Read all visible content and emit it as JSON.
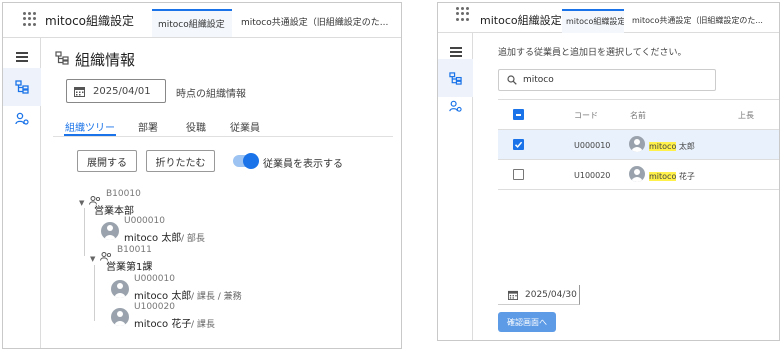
{
  "left": {
    "app_title": "mitoco組織設定",
    "tabs": [
      {
        "label": "mitoco組織設定"
      },
      {
        "label": "mitoco共通設定（旧組織設定のた..."
      }
    ],
    "page_title": "組織情報",
    "date": "2025/04/01",
    "date_suffix": "時点の組織情報",
    "subtabs": [
      "組織ツリー",
      "部署",
      "役職",
      "従業員"
    ],
    "buttons": {
      "expand": "展開する",
      "collapse": "折りたたむ"
    },
    "toggle_label": "従業員を表示する",
    "tree": {
      "dept1": {
        "code": "B10010",
        "name": "営業本部"
      },
      "emp1": {
        "code": "U000010",
        "name": "mitoco 太郎",
        "role": "/ 部長"
      },
      "dept2": {
        "code": "B10011",
        "name": "営業第1課"
      },
      "emp2": {
        "code": "U000010",
        "name": "mitoco 太郎",
        "role": "/ 課長 / 兼務"
      },
      "emp3": {
        "code": "U100020",
        "name": "mitoco 花子",
        "role": "/ 課長"
      }
    }
  },
  "right": {
    "app_title": "mitoco組織設定",
    "tabs": [
      {
        "label": "mitoco組織設定"
      },
      {
        "label": "mitoco共通設定（旧組織設定のた..."
      }
    ],
    "instruction": "追加する従業員と追加日を選択してください。",
    "search_value": "mitoco",
    "table": {
      "headers": {
        "code": "コード",
        "name": "名前",
        "title": "上長"
      },
      "rows": [
        {
          "code": "U000010",
          "name_hl": "mitoco",
          "name_rest": " 太郎",
          "checked": true
        },
        {
          "code": "U100020",
          "name_hl": "mitoco",
          "name_rest": " 花子",
          "checked": false
        }
      ]
    },
    "date": "2025/04/30",
    "confirm_label": "確認画面へ"
  },
  "colors": {
    "accent": "#1a73e8",
    "highlight": "#fff04a",
    "border": "#c9c9c9"
  }
}
